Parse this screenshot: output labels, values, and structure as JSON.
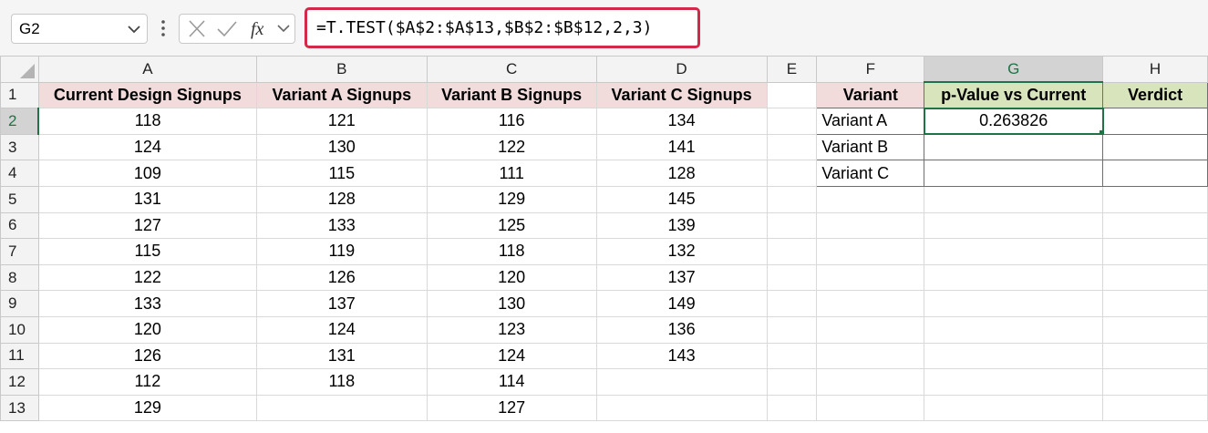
{
  "formula_bar": {
    "name_box": "G2",
    "formula": "=T.TEST($A$2:$A$13,$B$2:$B$12,2,3)"
  },
  "columns": [
    "A",
    "B",
    "C",
    "D",
    "E",
    "F",
    "G",
    "H"
  ],
  "rows": [
    "1",
    "2",
    "3",
    "4",
    "5",
    "6",
    "7",
    "8",
    "9",
    "10",
    "11",
    "12",
    "13"
  ],
  "headers": {
    "a": "Current Design Signups",
    "b": "Variant A Signups",
    "c": "Variant B Signups",
    "d": "Variant C Signups",
    "f": "Variant",
    "g": "p-Value vs Current",
    "h": "Verdict"
  },
  "data": [
    [
      "118",
      "121",
      "116",
      "134"
    ],
    [
      "124",
      "130",
      "122",
      "141"
    ],
    [
      "109",
      "115",
      "111",
      "128"
    ],
    [
      "131",
      "128",
      "129",
      "145"
    ],
    [
      "127",
      "133",
      "125",
      "139"
    ],
    [
      "115",
      "119",
      "118",
      "132"
    ],
    [
      "122",
      "126",
      "120",
      "137"
    ],
    [
      "133",
      "137",
      "130",
      "149"
    ],
    [
      "120",
      "124",
      "123",
      "136"
    ],
    [
      "126",
      "131",
      "124",
      "143"
    ],
    [
      "112",
      "118",
      "114",
      ""
    ],
    [
      "129",
      "",
      "127",
      ""
    ]
  ],
  "summary": {
    "variants": [
      "Variant A",
      "Variant B",
      "Variant C"
    ],
    "pvalues": [
      "0.263826",
      "",
      ""
    ],
    "verdicts": [
      "",
      "",
      ""
    ]
  },
  "colors": {
    "accent_green": "#217346",
    "formula_border": "#d2294a",
    "header_pink": "#f2dcdb",
    "header_green": "#d8e4bc"
  }
}
